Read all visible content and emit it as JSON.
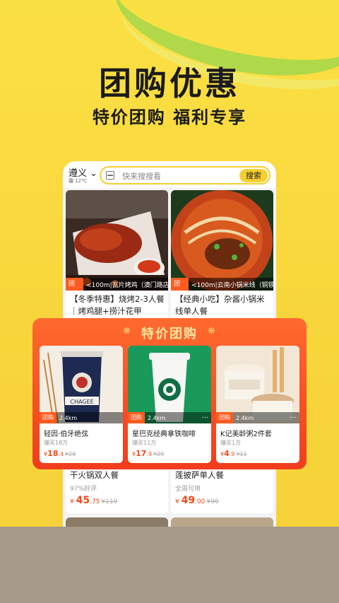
{
  "headline": {
    "title": "团购优惠",
    "subtitle": "特价团购  福利专享"
  },
  "topbar": {
    "city": "遵义",
    "city_arrow": "⌄",
    "weather": "霾 12℃",
    "search_placeholder": "快来搜搜看",
    "search_button": "搜索"
  },
  "cards": [
    {
      "tag": "团购",
      "location": "<100m|瓦片烤鸡（澳门路店",
      "title": "【冬季特惠】烧烤2-3人餐｜烤鸡腿+捞汁花甲+炝…"
    },
    {
      "tag": "团购",
      "location": "<100m|云南小锅米线（铜锣",
      "title": "【经典小吃】杂酱小锅米线单人餐"
    },
    {
      "title": "干火锅双人餐",
      "sub": "97%好评",
      "price_symbol": "¥",
      "price": "45",
      "price_dec": ".75",
      "orig": "¥119"
    },
    {
      "title": "莲披萨单人餐",
      "sub": "全周可用",
      "price_symbol": "¥",
      "price": "49",
      "price_dec": ".00",
      "orig": "¥99"
    }
  ],
  "special": {
    "title": "特价团购",
    "items": [
      {
        "tag": "团购",
        "distance": "2.4km",
        "name": "轻因·伯牙绝弦",
        "sold": "爆买18万",
        "price": "18",
        "price_dec": ".4",
        "orig": "¥20"
      },
      {
        "tag": "团购",
        "distance": "2.4km",
        "name": "星巴克经典拿铁咖啡",
        "sold": "爆买11万",
        "price": "17",
        "price_dec": ".9",
        "orig": "¥29"
      },
      {
        "tag": "团购",
        "distance": "2.4km",
        "name": "K记美龄粥2件套",
        "sold": "爆买1万",
        "price": "4",
        "price_dec": ".9",
        "orig": "¥11"
      }
    ],
    "currency": "¥"
  },
  "colors": {
    "accent": "#f7cf2f",
    "promo": "#f04a18"
  }
}
